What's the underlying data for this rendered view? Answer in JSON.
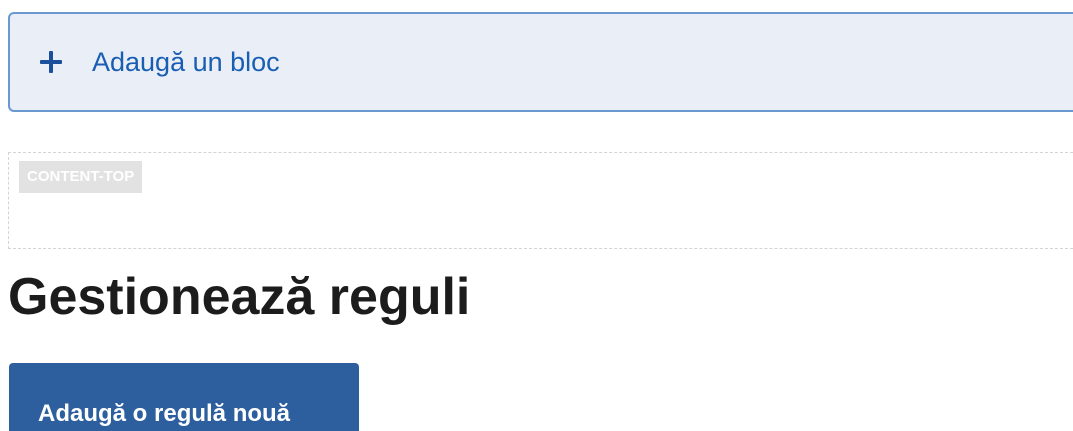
{
  "add_block": {
    "icon": "plus-icon",
    "label": "Adaugă un bloc"
  },
  "region": {
    "tag": "CONTENT-TOP"
  },
  "page": {
    "title": "Gestionează reguli"
  },
  "actions": {
    "add_rule_label": "Adaugă o regulă nouă"
  },
  "colors": {
    "add_block_bg": "#e9eef7",
    "add_block_border": "#6a98d1",
    "link_blue": "#1a5eb3",
    "primary_button": "#2d5f9e",
    "title_text": "#1c1c1c"
  }
}
